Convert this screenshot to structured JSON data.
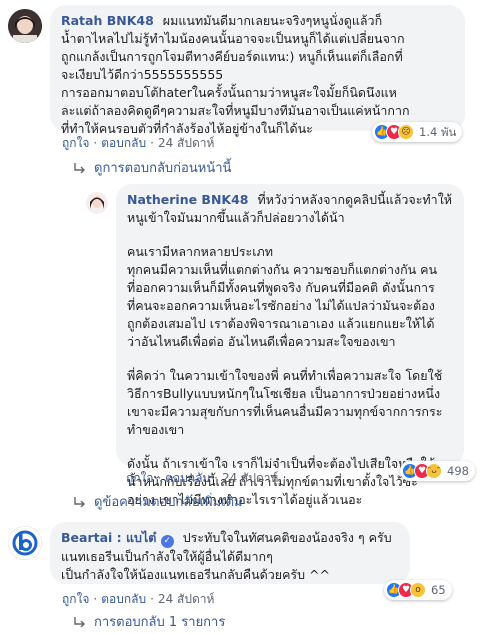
{
  "comments": [
    {
      "author": "Ratah BNK48",
      "text_lines": [
        "ผมแนทมันดีมากเลยนะจริงๆหนูนั่งดูแล้วก็",
        "น้ำตาไหลไปไม่รู้ทำไมน้องคนนั้นอาจจะเป็นหนูก็ได้แต่เปลี่ยนจาก",
        "ถูกแกล้งเป็นการถูกโจมตีทางคีย์บอร์ดแทน:) หนูก็เห็นแต่ก็เลือกที่",
        "จะเงียบไว้ดีกว่า5555555555",
        "การออกมาตอบโต้haterในครั้งนั้นถามว่าหนูสะใจมั้ยก็นิดนึงแห",
        "ละแต่ถ้าลองคิดดูดีๆความสะใจที่หนูมีบางทีมันอาจเป็นแค่หน้ากาก",
        "ที่ทำให้คนรอบตัวที่กำลังร้องไห้อยู่ข้างในก็ได้นะ"
      ],
      "actions": {
        "like": "ถูกใจ",
        "reply": "ตอบกลับ",
        "time": "24 สัปดาห์"
      },
      "reactions": {
        "types": [
          "like-icon",
          "love-icon",
          "sad-icon"
        ],
        "count": "1.4 พัน"
      }
    }
  ],
  "collapsed_replies_link": "ดูการตอบกลับก่อนหน้านี้",
  "reply": {
    "author": "Natherine BNK48",
    "paragraphs": [
      [
        "ที่หวังว่าหลังจากดูคลิปนี้แล้วจะทำให้",
        "หนูเข้าใจมันมากขึ้นแล้วก็ปล่อยวางได้น้า"
      ],
      [
        "คนเรามีหลากหลายประเภท",
        "ทุกคนมีความเห็นที่แตกต่างกัน ความชอบก็แตกต่างกัน คน",
        "ที่ออกความเห็นก็มีทั้งคนที่พูดจริง กับคนที่มีอคติ ดังนั้นการ",
        "ที่คนจะออกความเห็นอะไรซักอย่าง ไม่ได้แปลว่ามันจะต้อง",
        "ถูกต้องเสมอไป เราต้องพิจารณาเอาเอง แล้วแยกแยะให้ได้",
        "ว่าอันไหนดีเพื่อต่อ อันไหนดีเพื่อความสะใจของเขา"
      ],
      [
        "พี่คิดว่า ในความเข้าใจของพี่ คนที่ทำเพื่อความสะใจ โดยใช้",
        "วิธีการBullyแบบหนักๆในโซเชียล เป็นอาการป่วยอย่างหนึ่ง",
        "เขาจะมีความสุขกับการที่เห็นคนอื่นมีความทุกข์จากการกระ",
        "ทำของเขา"
      ],
      [
        "ดังนั้น ถ้าเราเข้าใจ เราก็ไม่จำเป็นที่จะต้องไปเสียใจหรือให้",
        "น้ำหนักกับเรื่องนี้เลย ถ้าเราไม่ทุกข์ตามที่เขาตั้งใจไว้ซะ",
        "อย่าง เขาไม่มีทางทำอะไรเราได้อยู่แล้วเนอะ"
      ]
    ],
    "actions": {
      "like": "ถูกใจ",
      "reply": "ตอบกลับ",
      "time": "24 สัปดาห์"
    },
    "reactions": {
      "types": [
        "like-icon",
        "love-icon",
        "haha-icon"
      ],
      "count": "498"
    }
  },
  "more_replies_link": "ดูข้อความตอบกลับเพิ่มเติม",
  "beartai": {
    "author": "Beartai : แบไต๋",
    "text_lines": [
      "ประทับใจในทัศนคติของน้องจริง ๆ ครับ",
      "แนทเธอรีนเป็นกำลังใจให้ผู้อื่นได้ดีมากๆ",
      "เป็นกำลังใจให้น้องแนทเธอรีนกลับคืนด้วยครับ ^^"
    ],
    "actions": {
      "like": "ถูกใจ",
      "reply": "ตอบกลับ",
      "time": "24 สัปดาห์"
    },
    "reactions": {
      "types": [
        "like-icon",
        "love-icon",
        "wow-icon"
      ],
      "count": "65"
    }
  },
  "reply_count_link": "การตอบกลับ 1 รายการ",
  "colors": {
    "link": "#385898",
    "bubble": "#f2f3f5",
    "meta": "#606770"
  }
}
